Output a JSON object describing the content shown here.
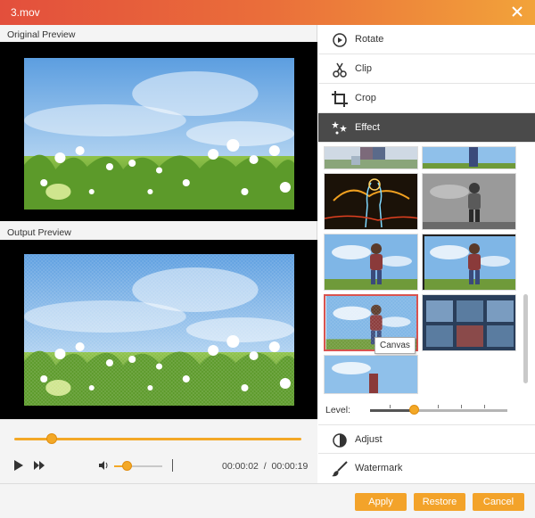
{
  "window": {
    "title": "3.mov",
    "close_icon": "close-icon"
  },
  "left_panel": {
    "original_preview_label": "Original Preview",
    "output_preview_label": "Output Preview"
  },
  "playback": {
    "progress": 0.13,
    "current_time": "00:00:02",
    "separator": "/",
    "total_time": "00:00:19",
    "volume": 0.25,
    "icons": {
      "play": "play-icon",
      "fast_forward": "fast-forward-icon",
      "volume": "volume-icon"
    }
  },
  "right_panel": {
    "menu": [
      {
        "label": "Rotate",
        "icon": "rotate-icon",
        "active": false
      },
      {
        "label": "Clip",
        "icon": "scissors-icon",
        "active": false
      },
      {
        "label": "Crop",
        "icon": "crop-icon",
        "active": false
      },
      {
        "label": "Effect",
        "icon": "effect-stars-icon",
        "active": true
      }
    ],
    "effect_tooltip": "Canvas",
    "level": {
      "label": "Level:",
      "value": 0.32
    },
    "bottom_menu": [
      {
        "label": "Adjust",
        "icon": "adjust-icon"
      },
      {
        "label": "Watermark",
        "icon": "brush-icon"
      }
    ]
  },
  "footer": {
    "apply_label": "Apply",
    "restore_label": "Restore",
    "cancel_label": "Cancel"
  },
  "colors": {
    "accent": "#f3a32a",
    "title_start": "#e34f3c",
    "title_end": "#f2a33a",
    "active_menu": "#4a4a4a",
    "selected_border": "#d9534f"
  }
}
